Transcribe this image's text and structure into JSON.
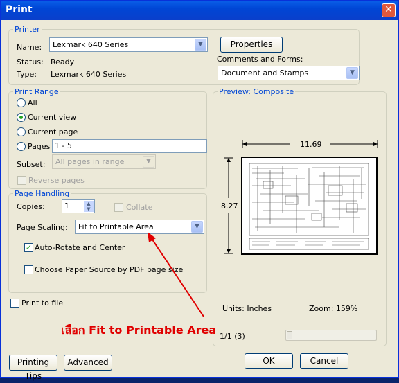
{
  "window": {
    "title": "Print"
  },
  "printer": {
    "legend": "Printer",
    "name_label": "Name:",
    "name_value": "Lexmark 640 Series",
    "status_label": "Status:",
    "status_value": "Ready",
    "type_label": "Type:",
    "type_value": "Lexmark 640 Series",
    "properties_button": "Properties",
    "comments_label": "Comments and Forms:",
    "comments_value": "Document and Stamps"
  },
  "print_range": {
    "legend": "Print Range",
    "options": [
      "All",
      "Current view",
      "Current page",
      "Pages"
    ],
    "selected": "Current view",
    "pages_value": "1 - 5",
    "subset_label": "Subset:",
    "subset_value": "All pages in range",
    "reverse_label": "Reverse pages"
  },
  "page_handling": {
    "legend": "Page Handling",
    "copies_label": "Copies:",
    "copies_value": "1",
    "collate_label": "Collate",
    "scaling_label": "Page Scaling:",
    "scaling_value": "Fit to Printable Area",
    "auto_rotate_label": "Auto-Rotate and Center",
    "auto_rotate_checked": true,
    "paper_source_label": "Choose Paper Source by PDF page size",
    "paper_source_checked": false
  },
  "print_to_file_label": "Print to file",
  "preview": {
    "legend": "Preview: Composite",
    "width_label": "11.69",
    "height_label": "8.27",
    "units_label": "Units: Inches",
    "zoom_label": "Zoom: 159%",
    "page_counter": "1/1 (3)",
    "slider_position": 0
  },
  "buttons": {
    "printing_tips": "Printing Tips",
    "advanced": "Advanced",
    "ok": "OK",
    "cancel": "Cancel"
  },
  "annotation": "เลือก Fit to Printable Area",
  "colors": {
    "title_bar": "#0046d5",
    "legend_text": "#0046d5",
    "annotation": "#e00000",
    "check_mark": "#21a121"
  }
}
